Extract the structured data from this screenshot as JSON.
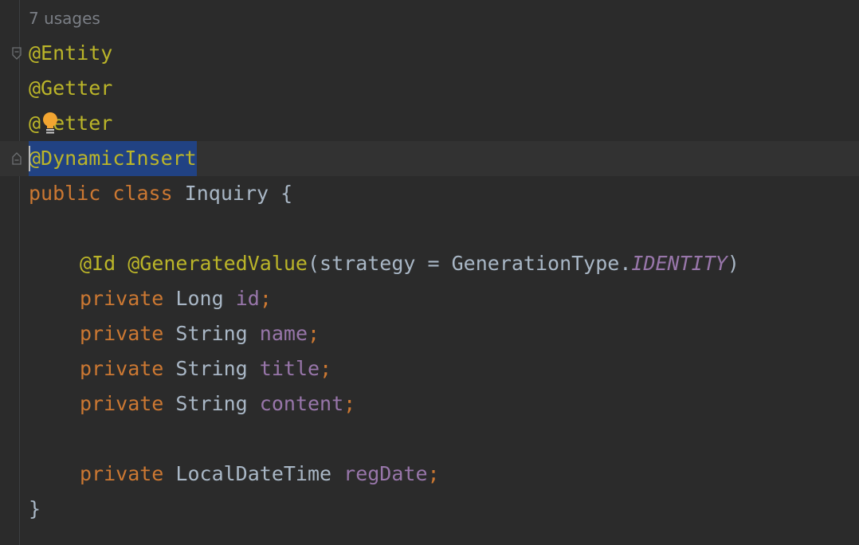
{
  "editor": {
    "usages_hint": "7 usages",
    "annotations": {
      "entity": "@Entity",
      "getter": "@Getter",
      "setter_prefix": "@",
      "setter_rest": "etter",
      "dynamic_insert": "@DynamicInsert"
    },
    "class_decl": {
      "kw_public": "public",
      "kw_class": "class",
      "name": "Inquiry",
      "open_brace": "{",
      "close_brace": "}"
    },
    "id_annotation": {
      "id": "@Id",
      "generated": "@GeneratedValue",
      "args_open": "(strategy = GenerationType.",
      "constant": "IDENTITY",
      "args_close": ")"
    },
    "fields": [
      {
        "modifier": "private",
        "type": "Long",
        "name": "id",
        "semi": ";"
      },
      {
        "modifier": "private",
        "type": "String",
        "name": "name",
        "semi": ";"
      },
      {
        "modifier": "private",
        "type": "String",
        "name": "title",
        "semi": ";"
      },
      {
        "modifier": "private",
        "type": "String",
        "name": "content",
        "semi": ";"
      },
      {
        "modifier": "private",
        "type": "LocalDateTime",
        "name": "regDate",
        "semi": ";"
      }
    ],
    "icons": {
      "fold_start": "fold-start-icon",
      "fold_end": "fold-end-icon",
      "intention_bulb": "lightbulb-icon"
    },
    "colors": {
      "background": "#2b2b2b",
      "annotation": "#bbb529",
      "keyword": "#cc7832",
      "identifier": "#a9b7c6",
      "field": "#9876aa",
      "selection": "#214283",
      "bulb": "#f2a531"
    }
  }
}
